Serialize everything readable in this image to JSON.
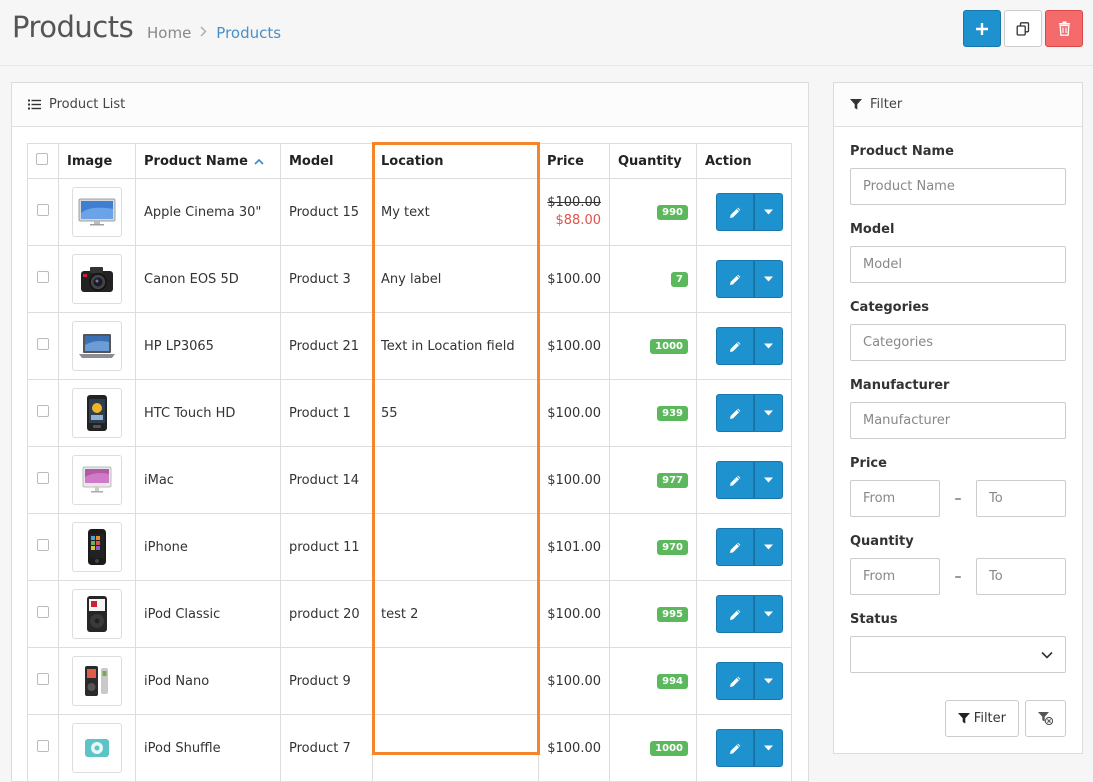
{
  "header": {
    "title": "Products",
    "breadcrumb": [
      {
        "label": "Home"
      },
      {
        "label": "Products"
      }
    ],
    "buttons": {
      "add_icon": "plus-icon",
      "copy_icon": "copy-icon",
      "delete_icon": "trash-icon"
    }
  },
  "list": {
    "heading": "Product List",
    "columns": {
      "image": "Image",
      "name": "Product Name",
      "model": "Model",
      "location": "Location",
      "price": "Price",
      "quantity": "Quantity",
      "action": "Action"
    },
    "rows": [
      {
        "name": "Apple Cinema 30\"",
        "model": "Product 15",
        "location": "My text",
        "price": "$100.00",
        "special": "$88.00",
        "quantity": "990",
        "thumb": "monitor"
      },
      {
        "name": "Canon EOS 5D",
        "model": "Product 3",
        "location": "Any label",
        "price": "$100.00",
        "special": "",
        "quantity": "7",
        "thumb": "camera"
      },
      {
        "name": "HP LP3065",
        "model": "Product 21",
        "location": "Text in Location field",
        "price": "$100.00",
        "special": "",
        "quantity": "1000",
        "thumb": "laptop"
      },
      {
        "name": "HTC Touch HD",
        "model": "Product 1",
        "location": "55",
        "price": "$100.00",
        "special": "",
        "quantity": "939",
        "thumb": "phone-dark"
      },
      {
        "name": "iMac",
        "model": "Product 14",
        "location": "",
        "price": "$100.00",
        "special": "",
        "quantity": "977",
        "thumb": "imac"
      },
      {
        "name": "iPhone",
        "model": "product 11",
        "location": "",
        "price": "$101.00",
        "special": "",
        "quantity": "970",
        "thumb": "iphone"
      },
      {
        "name": "iPod Classic",
        "model": "product 20",
        "location": "test 2",
        "price": "$100.00",
        "special": "",
        "quantity": "995",
        "thumb": "ipod"
      },
      {
        "name": "iPod Nano",
        "model": "Product 9",
        "location": "",
        "price": "$100.00",
        "special": "",
        "quantity": "994",
        "thumb": "ipod-nano"
      },
      {
        "name": "iPod Shuffle",
        "model": "Product 7",
        "location": "",
        "price": "$100.00",
        "special": "",
        "quantity": "1000",
        "thumb": "ipod-shuffle"
      }
    ]
  },
  "filter": {
    "heading": "Filter",
    "product_name": {
      "label": "Product Name",
      "placeholder": "Product Name"
    },
    "model": {
      "label": "Model",
      "placeholder": "Model"
    },
    "categories": {
      "label": "Categories",
      "placeholder": "Categories"
    },
    "manufacturer": {
      "label": "Manufacturer",
      "placeholder": "Manufacturer"
    },
    "price": {
      "label": "Price",
      "from": "From",
      "to": "To"
    },
    "quantity": {
      "label": "Quantity",
      "from": "From",
      "to": "To"
    },
    "status": {
      "label": "Status",
      "value": ""
    },
    "range_separator": "–",
    "filter_button": "Filter"
  },
  "colors": {
    "primary": "#1e91cf",
    "danger": "#f56b6b",
    "badge": "#5cb85c",
    "special_price": "#e0534a",
    "link": "#3f87c5",
    "highlight": "#f5852b"
  }
}
